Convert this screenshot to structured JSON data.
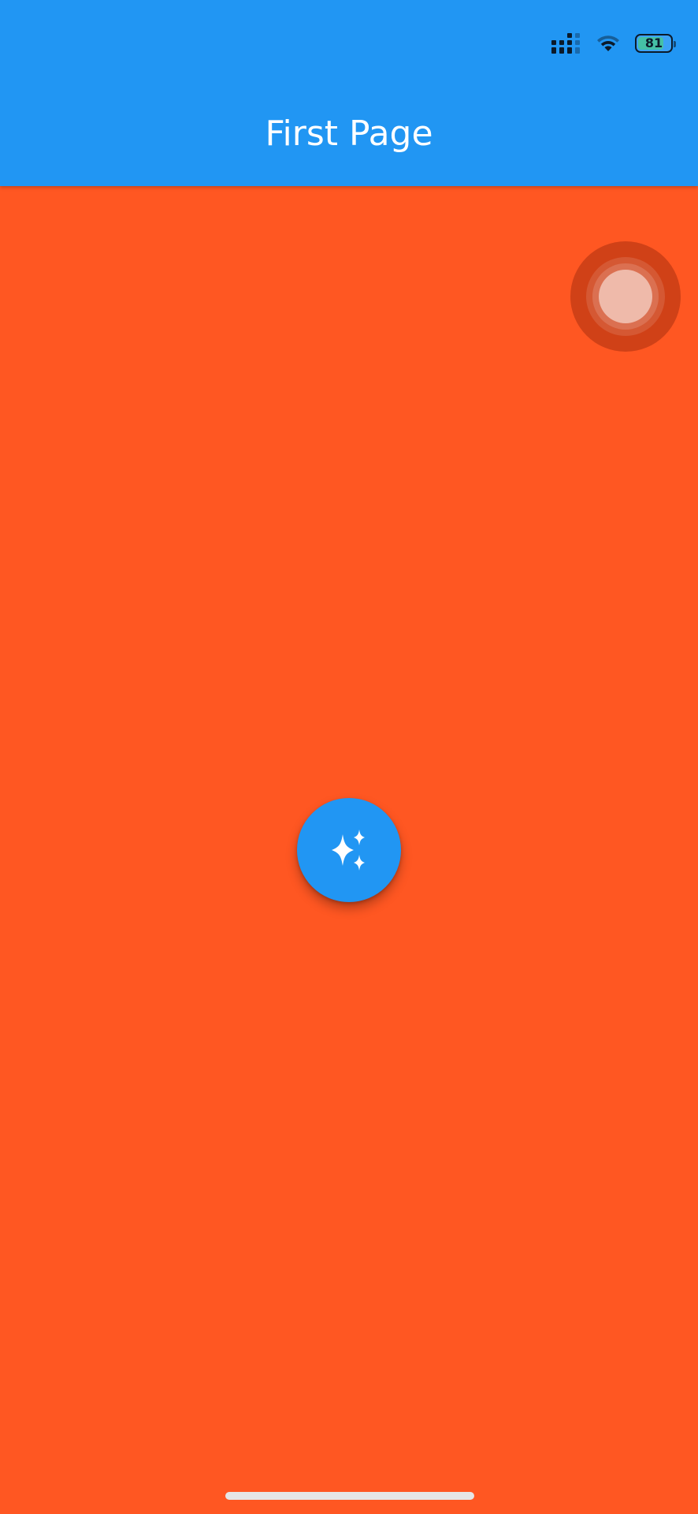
{
  "status_bar": {
    "signal_icon": "cellular-signal-icon",
    "wifi_icon": "wifi-icon",
    "battery_percent": "81",
    "battery_level": 0.81
  },
  "app_bar": {
    "title": "First Page",
    "color": "#2196F3"
  },
  "body": {
    "background_color": "#FF5722"
  },
  "fab": {
    "icon": "sparkles-icon",
    "color": "#2196F3"
  },
  "assistive_touch": {
    "icon": "assistive-touch-icon"
  }
}
